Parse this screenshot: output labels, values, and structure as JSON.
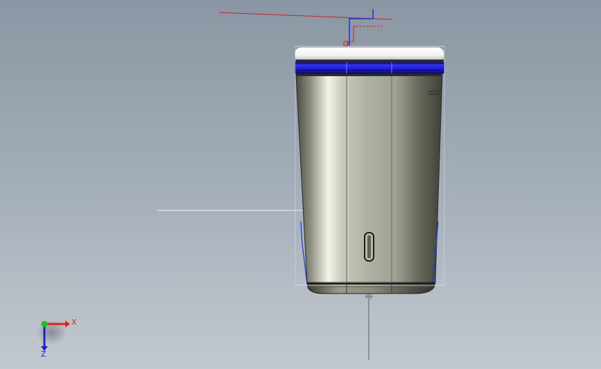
{
  "viewport": {
    "background_top": "#8a96a3",
    "background_bottom": "#c2c8cf"
  },
  "model": {
    "part": "cup-body",
    "body_color": "#b4b6a8",
    "lid_color": "#f5f5f5",
    "seal_color": "#1a1ad0",
    "sketch_color_red": "#cc2222",
    "sketch_color_blue": "#2233cc"
  },
  "triad": {
    "x_label": "X",
    "z_label": "Z",
    "x_color": "#e02020",
    "y_color": "#20c020",
    "z_color": "#2020d0"
  }
}
